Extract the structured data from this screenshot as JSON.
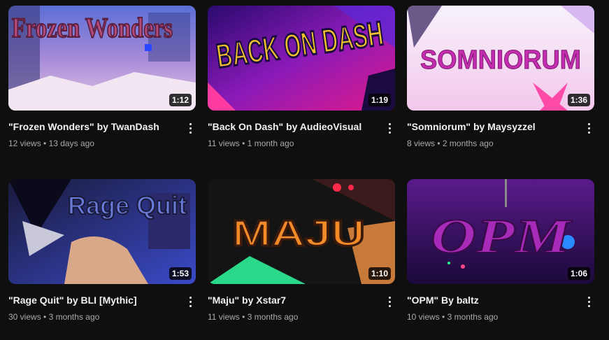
{
  "videos": [
    {
      "title": "\"Frozen Wonders\" by TwanDash",
      "views": "12 views",
      "age": "13 days ago",
      "duration": "1:12",
      "thumb_text": "Frozen Wonders"
    },
    {
      "title": "\"Back On Dash\" by AudieoVisual",
      "views": "11 views",
      "age": "1 month ago",
      "duration": "1:19",
      "thumb_text": "BACK ON DASH"
    },
    {
      "title": "\"Somniorum\" by Maysyzzel",
      "views": "8 views",
      "age": "2 months ago",
      "duration": "1:36",
      "thumb_text": "SOMNIORUM"
    },
    {
      "title": "\"Rage Quit\" by BLI [Mythic]",
      "views": "30 views",
      "age": "3 months ago",
      "duration": "1:53",
      "thumb_text": "Rage Quit"
    },
    {
      "title": "\"Maju\" by Xstar7",
      "views": "11 views",
      "age": "3 months ago",
      "duration": "1:10",
      "thumb_text": "MAJU"
    },
    {
      "title": "\"OPM\" By baltz",
      "views": "10 views",
      "age": "3 months ago",
      "duration": "1:06",
      "thumb_text": "OPM"
    }
  ],
  "separator": "•",
  "colors": {
    "background": "#0f0f0f",
    "title_text": "#f1f1f1",
    "meta_text": "#aaaaaa"
  },
  "icons": {
    "more": "more-vert-icon"
  }
}
